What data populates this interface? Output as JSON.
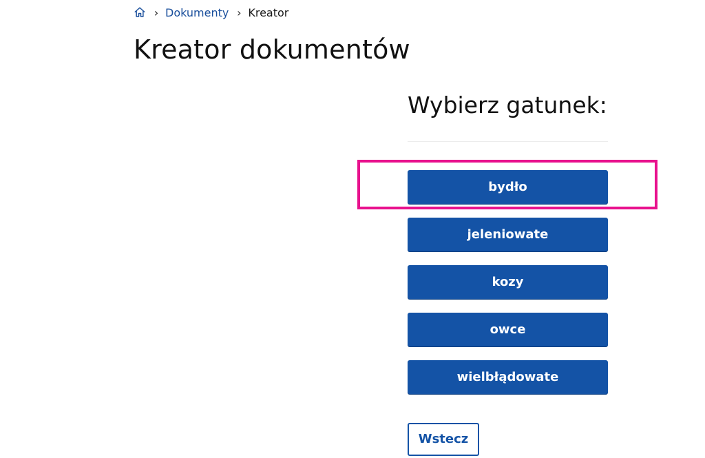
{
  "breadcrumb": {
    "home_icon": "home-icon",
    "items": [
      {
        "label": "Dokumenty"
      },
      {
        "label": "Kreator"
      }
    ]
  },
  "page_title": "Kreator dokumentów",
  "section_title": "Wybierz gatunek:",
  "species": [
    {
      "label": "bydło"
    },
    {
      "label": "jeleniowate"
    },
    {
      "label": "kozy"
    },
    {
      "label": "owce"
    },
    {
      "label": "wielbłądowate"
    }
  ],
  "back_label": "Wstecz",
  "colors": {
    "primary": "#1453a6",
    "link": "#1a4f9c",
    "highlight": "#e8118d"
  }
}
